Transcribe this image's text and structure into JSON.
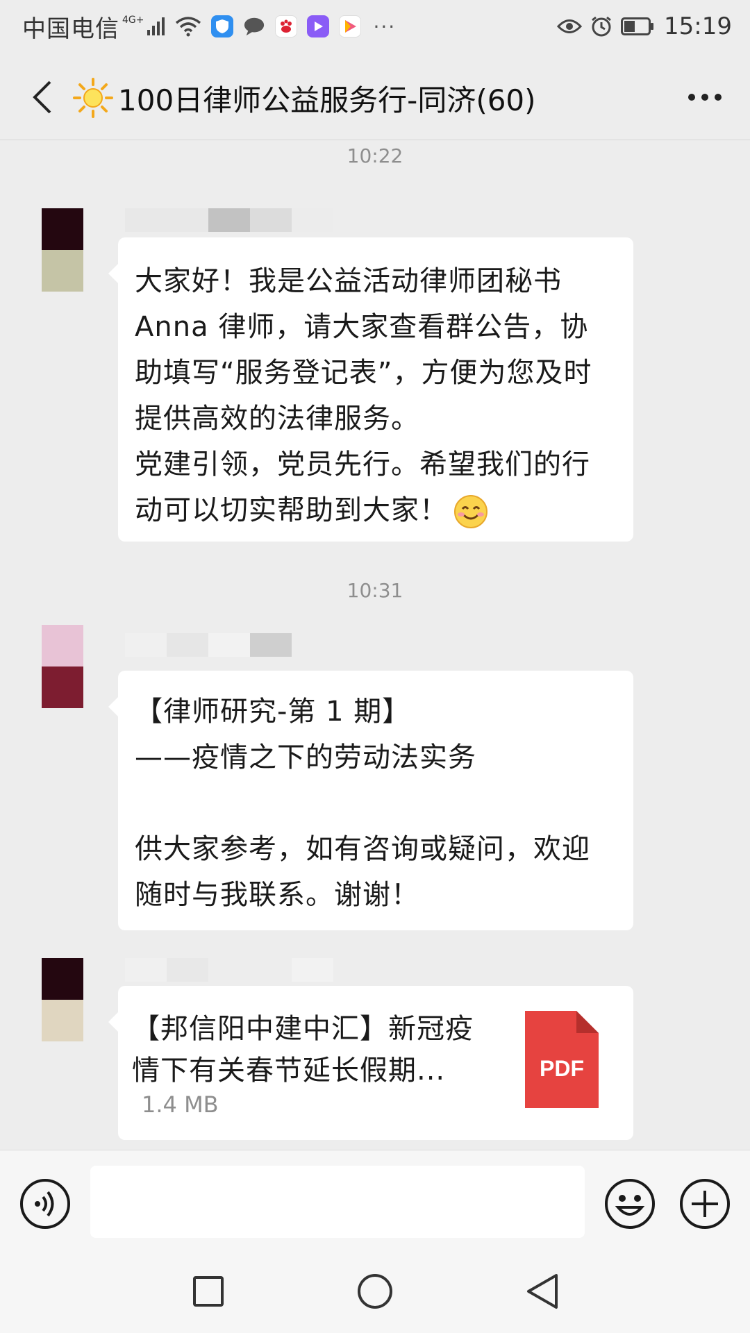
{
  "status_bar": {
    "carrier": "中国电信",
    "network_type": "4G+",
    "time": "15:19"
  },
  "header": {
    "title": "100日律师公益服务行-同济(60)"
  },
  "messages": [
    {
      "timestamp": "10:22",
      "text": "大家好！我是公益活动律师团秘书Anna 律师，请大家查看群公告，协助填写“服务登记表”，方便为您及时提供高效的法律服务。\n党建引领，党员先行。希望我们的行动可以切实帮助到大家！"
    },
    {
      "timestamp": "10:31",
      "text": "【律师研究-第 1 期】\n——疫情之下的劳动法实务\n\n供大家参考，如有咨询或疑问，欢迎随时与我联系。谢谢！"
    },
    {
      "file_title": "【邦信阳中建中汇】新冠疫情下有关春节延长假期...",
      "file_size": "1.4 MB",
      "file_type": "PDF"
    }
  ],
  "input": {
    "value": ""
  },
  "colors": {
    "background": "#ededed",
    "bubble": "#ffffff",
    "pdf_red": "#e64340"
  }
}
